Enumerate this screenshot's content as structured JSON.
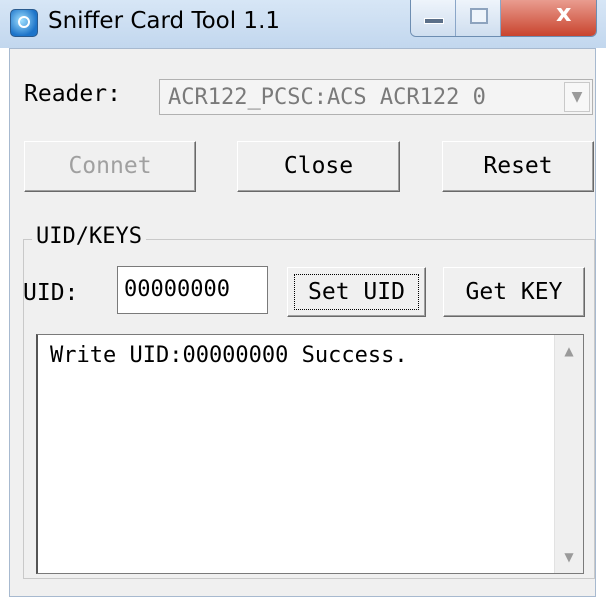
{
  "window": {
    "title": "Sniffer Card Tool 1.1",
    "close_glyph": "x"
  },
  "reader": {
    "label": "Reader:",
    "selected": "ACR122_PCSC:ACS ACR122 0",
    "arrow": "▼"
  },
  "buttons": {
    "connect": "Connet",
    "close": "Close",
    "reset": "Reset",
    "set_uid": "Set UID",
    "get_key": "Get KEY"
  },
  "group": {
    "title": "UID/KEYS"
  },
  "uid": {
    "label": "UID:",
    "value": "00000000"
  },
  "log": {
    "text": "Write UID:00000000 Success.",
    "up": "▲",
    "down": "▼"
  },
  "icons": {
    "app": "sniffer-app-icon"
  }
}
